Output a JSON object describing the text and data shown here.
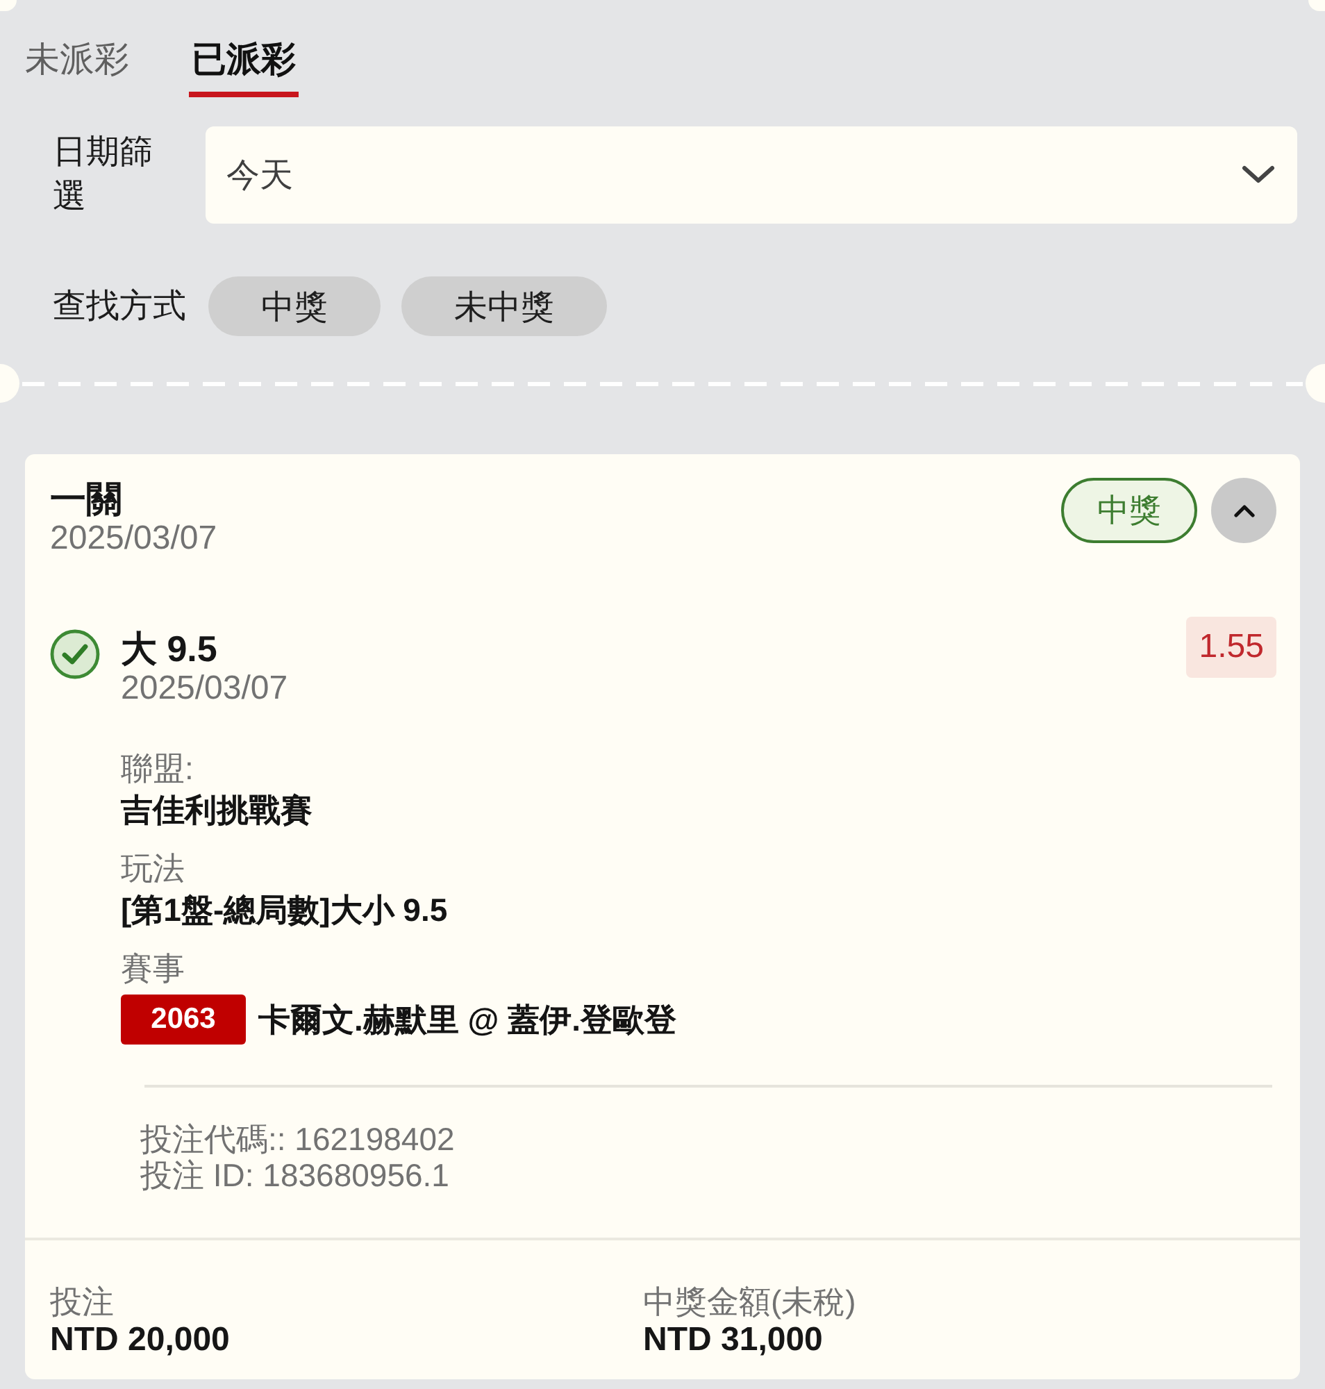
{
  "tabs": [
    {
      "label": "未派彩",
      "selected": false
    },
    {
      "label": "已派彩",
      "selected": true
    }
  ],
  "filters": {
    "date_label": "日期篩選",
    "date_value": "今天",
    "search_label": "查找方式",
    "search_options": [
      {
        "label": "中獎",
        "selected": false
      },
      {
        "label": "未中獎",
        "selected": false
      }
    ]
  },
  "bets": [
    {
      "type": "一關",
      "date": "2025/03/07",
      "status": "中獎",
      "won": true,
      "expanded": true,
      "selections": [
        {
          "won": true,
          "pick": "大 9.5",
          "date": "2025/03/07",
          "odds": "1.55",
          "league_label": "聯盟:",
          "league": "吉佳利挑戰賽",
          "market_label": "玩法",
          "market": "[第1盤-總局數]大小 9.5",
          "event_label": "賽事",
          "event_code": "2063",
          "event": "卡爾文.赫默里 @ 蓋伊.登歐登"
        }
      ],
      "bet_code": "投注代碼:: 162198402",
      "bet_id": "投注 ID: 183680956.1",
      "stake_label": "投注",
      "stake": "NTD 20,000",
      "payout_label": "中獎金額(未稅)",
      "payout": "NTD 31,000"
    }
  ]
}
